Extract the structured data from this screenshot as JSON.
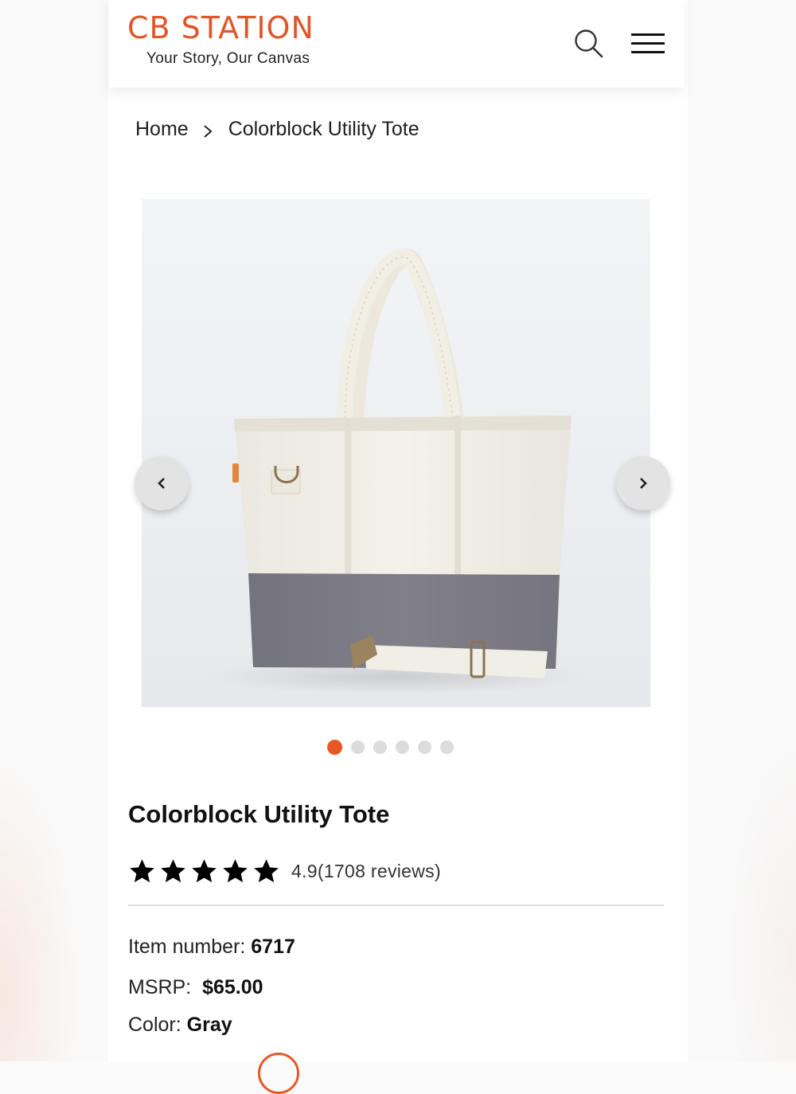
{
  "header": {
    "logo": "CB STATION",
    "tagline": "Your Story, Our Canvas",
    "search_icon": "search-icon",
    "menu_icon": "hamburger-menu-icon"
  },
  "breadcrumb": {
    "home": "Home",
    "current": "Colorblock Utility Tote"
  },
  "gallery": {
    "image_alt": "Colorblock Utility Tote",
    "slide_count": 6,
    "active_slide": 1
  },
  "product": {
    "title": "Colorblock Utility Tote",
    "stars": 5,
    "rating": "4.9",
    "reviews": "(1708 reviews)",
    "item_number_label": "Item number:",
    "item_number": "6717",
    "msrp_label": "MSRP:",
    "msrp": "$65.00",
    "color_label": "Color:",
    "color": "Gray"
  },
  "colors": {
    "brand": "#e0562a",
    "active_dot": "#e75726",
    "bag_canvas": "#f1eee6",
    "bag_bottom": "#7b7a82"
  }
}
